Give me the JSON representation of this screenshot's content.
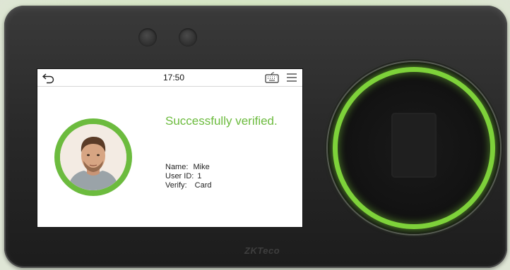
{
  "statusbar": {
    "time": "17:50"
  },
  "result": {
    "message": "Successfully verified.",
    "name_label": "Name:",
    "name_value": "Mike",
    "userid_label": "User ID:",
    "userid_value": "1",
    "verify_label": "Verify:",
    "verify_value": "Card"
  },
  "device": {
    "brand": "ZKTeco"
  },
  "icons": [
    "back-icon",
    "keyboard-icon",
    "menu-icon",
    "user-photo"
  ],
  "colors": {
    "accent": "#6cbb3e",
    "ring": "#7ed23a",
    "body": "#2a2a2a"
  }
}
